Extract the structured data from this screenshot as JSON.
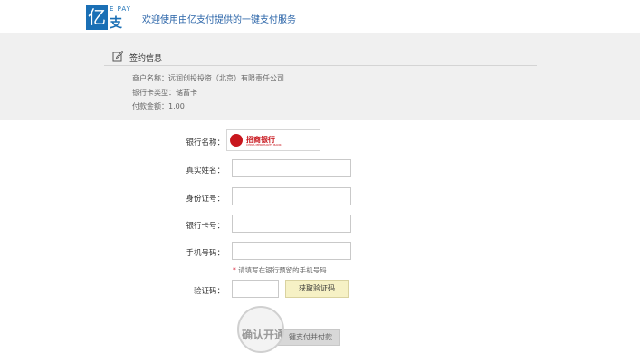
{
  "header": {
    "logo_char": "亿",
    "logo_small": "E PAY",
    "logo_big": "支付",
    "welcome": "欢迎使用由亿支付提供的一键支付服务"
  },
  "contract": {
    "title": "签约信息",
    "merchant": "商户名称：远润创投投资（北京）有限责任公司",
    "card_type": "银行卡类型：储蓄卡",
    "amount": "付款金额：1.00"
  },
  "form": {
    "bank_label": "银行名称：",
    "bank_name": "招商银行",
    "bank_sub": "CHINA MERCHANTS BANK",
    "name_label": "真实姓名：",
    "id_label": "身份证号：",
    "card_label": "银行卡号：",
    "phone_label": "手机号码：",
    "hint_star": "*",
    "hint": "请填写在银行预留的手机号码",
    "code_label": "验证码：",
    "get_code": "获取验证码",
    "submit": "键支付并付款",
    "magnifier": "确认开通"
  },
  "colors": {
    "brand": "#1a6fb5",
    "link": "#2a64a8",
    "bank_red": "#c8161d",
    "code_btn_bg": "#f6f1c5"
  }
}
